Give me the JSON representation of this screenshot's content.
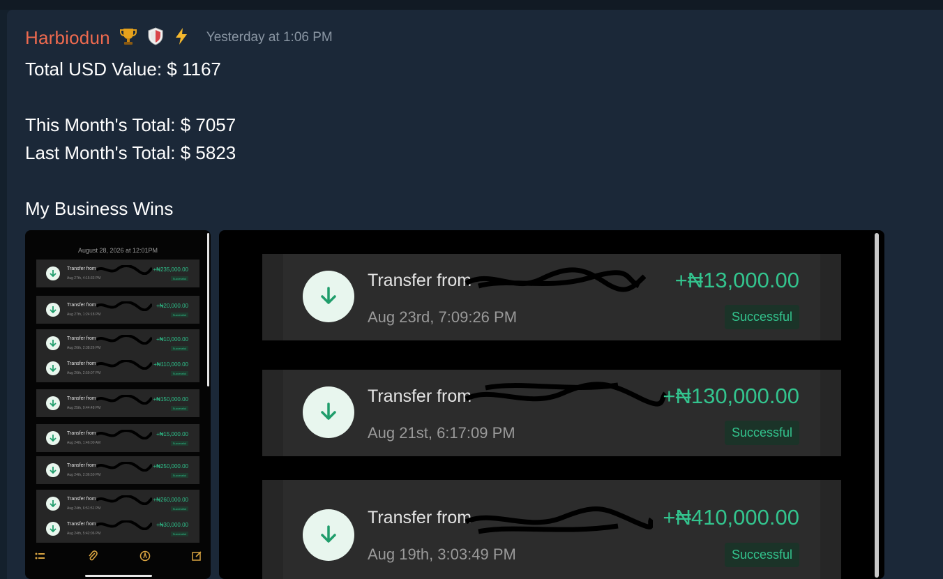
{
  "message": {
    "author": "Harbiodun",
    "badges": [
      "trophy-icon",
      "shield-icon",
      "lightning-icon"
    ],
    "timestamp": "Yesterday at 1:06 PM",
    "lines": [
      "Total USD Value: $ 1167",
      "This Month's Total: $ 7057",
      "Last Month's Total: $ 5823",
      "My Business Wins"
    ]
  },
  "thumb": {
    "date": "August 28, 2026 at 12:01PM",
    "rows": [
      {
        "title": "Transfer from",
        "date": "Aug 27th, 4:15:33 PM",
        "amount": "+₦235,000.00",
        "status": "Successful"
      },
      {
        "title": "Transfer from",
        "date": "Aug 27th, 1:24:18 PM",
        "amount": "+₦20,000.00",
        "status": "Successful"
      },
      {
        "title": "Transfer from",
        "date": "Aug 26th, 2:38:26 PM",
        "amount": "+₦10,000.00",
        "status": "Successful"
      },
      {
        "title": "Transfer from",
        "date": "Aug 26th, 2:59:07 PM",
        "amount": "+₦110,000.00",
        "status": "Successful"
      },
      {
        "title": "Transfer from",
        "date": "Aug 25th, 9:44:48 PM",
        "amount": "+₦150,000.00",
        "status": "Successful"
      },
      {
        "title": "Transfer from",
        "date": "Aug 24th, 1:46:00 AM",
        "amount": "+₦15,000.00",
        "status": "Successful"
      },
      {
        "title": "Transfer from",
        "date": "Aug 24th, 2:36:50 PM",
        "amount": "+₦250,000.00",
        "status": "Successful"
      },
      {
        "title": "Transfer from",
        "date": "Aug 24th, 6:51:51 PM",
        "amount": "+₦260,000.00",
        "status": "Successful"
      },
      {
        "title": "Transfer from",
        "date": "Aug 24th, 5:42:06 PM",
        "amount": "+₦30,000.00",
        "status": "Successful"
      }
    ]
  },
  "transactions": [
    {
      "title": "Transfer from",
      "date": "Aug 23rd, 7:09:26 PM",
      "amount": "+₦13,000.00",
      "status": "Successful"
    },
    {
      "title": "Transfer from",
      "date": "Aug 21st, 6:17:09 PM",
      "amount": "+₦130,000.00",
      "status": "Successful"
    },
    {
      "title": "Transfer from",
      "date": "Aug 19th, 3:03:49 PM",
      "amount": "+₦410,000.00",
      "status": "Successful"
    }
  ]
}
